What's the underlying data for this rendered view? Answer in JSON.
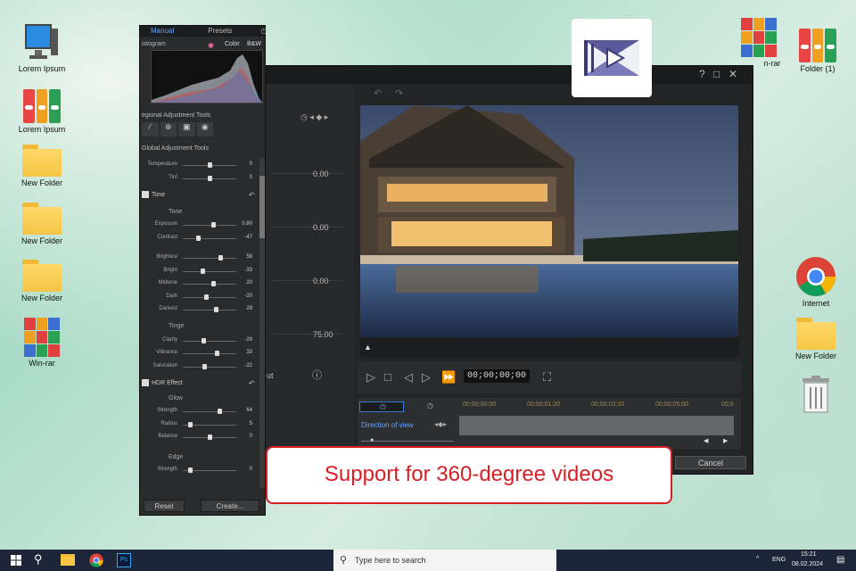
{
  "desktop_left": [
    {
      "type": "computer",
      "label": "Lorem Ipsum"
    },
    {
      "type": "binder",
      "label": "Lorem Ipsum"
    },
    {
      "type": "folder",
      "label": "New Folder"
    },
    {
      "type": "folder",
      "label": "New Folder"
    },
    {
      "type": "folder",
      "label": "New Folder"
    },
    {
      "type": "winrar",
      "label": "Win-rar"
    }
  ],
  "desktop_right": [
    {
      "type": "winrar",
      "label": "n-rar"
    },
    {
      "type": "binder",
      "label": "Folder (1)"
    },
    {
      "type": "chrome",
      "label": "Internet"
    },
    {
      "type": "folder",
      "label": "New Folder"
    },
    {
      "type": "trash",
      "label": ""
    }
  ],
  "editor": {
    "title_buttons": [
      "?",
      "□",
      "✕"
    ],
    "left_values": [
      "0.00",
      "0.00",
      "0.00",
      "75.00"
    ],
    "left_partial_label": "ut",
    "timecode": "00;00;00;00",
    "direction_label": "Direction of view",
    "ticks": [
      "00;00;00;00",
      "00;00;01;20",
      "00;00;03;10",
      "00;00;05;00",
      "00;0"
    ],
    "cancel_label": "Cancel"
  },
  "panel": {
    "tabs": [
      "Manual",
      "Presets"
    ],
    "histogram_label": "istogram",
    "color_label": "Color",
    "bw_label": "B&W",
    "regional": "egional Adjustment Tools",
    "global": "Global Adjustment Tools",
    "top_sliders": [
      {
        "label": "Temperature",
        "value": "0",
        "pos": 0.5
      },
      {
        "label": "Tint",
        "value": "0",
        "pos": 0.5
      }
    ],
    "tone_label": "Tone",
    "tone_header": "Tone",
    "tone_sliders": [
      {
        "label": "Exposure",
        "value": "0.80",
        "pos": 0.58
      },
      {
        "label": "Contrast",
        "value": "-47",
        "pos": 0.27
      }
    ],
    "tone2_sliders": [
      {
        "label": "Brightest",
        "value": "58",
        "pos": 0.72
      },
      {
        "label": "Bright",
        "value": "-33",
        "pos": 0.35
      },
      {
        "label": "Midtone",
        "value": "20",
        "pos": 0.58
      },
      {
        "label": "Dark",
        "value": "-20",
        "pos": 0.42
      },
      {
        "label": "Darkest",
        "value": "29",
        "pos": 0.63
      }
    ],
    "tinge_header": "Tinge",
    "tinge_sliders": [
      {
        "label": "Clarity",
        "value": "-29",
        "pos": 0.37
      },
      {
        "label": "Vibrance",
        "value": "33",
        "pos": 0.65
      },
      {
        "label": "Saturation",
        "value": "-22",
        "pos": 0.4
      }
    ],
    "hdr_label": "HDR Effect",
    "glow_header": "Glow",
    "glow_sliders": [
      {
        "label": "Strength",
        "value": "64",
        "pos": 0.7
      },
      {
        "label": "Radius",
        "value": "5",
        "pos": 0.1
      },
      {
        "label": "Balance",
        "value": "0",
        "pos": 0.5
      }
    ],
    "edge_header": "Edge",
    "edge_sliders": [
      {
        "label": "Strength",
        "value": "0",
        "pos": 0.1
      }
    ],
    "reset_label": "Reset",
    "create_label": "Create..."
  },
  "banner": "Support for 360-degree videos",
  "taskbar": {
    "search_placeholder": "Type here to search",
    "lang": "ENG",
    "time": "15:21",
    "date": "08.02.2024"
  }
}
